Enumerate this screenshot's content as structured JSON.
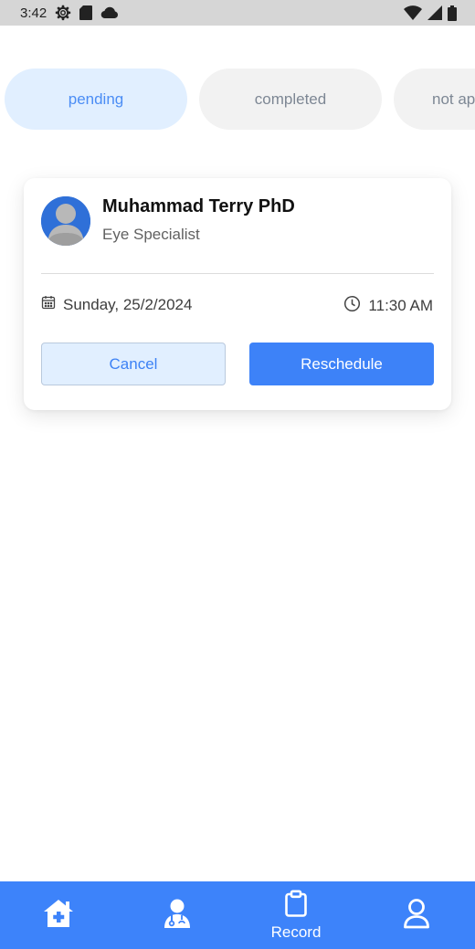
{
  "status_bar": {
    "time": "3:42",
    "icons": [
      "settings-gear-icon",
      "sd-card-icon",
      "cloud-icon",
      "wifi-icon",
      "signal-icon",
      "battery-icon"
    ]
  },
  "tabs": [
    {
      "label": "pending",
      "active": true
    },
    {
      "label": "completed",
      "active": false
    },
    {
      "label": "not ap",
      "active": false
    }
  ],
  "appointment": {
    "doctor_name": "Muhammad Terry PhD",
    "specialty": "Eye Specialist",
    "date": "Sunday, 25/2/2024",
    "time": "11:30 AM",
    "cancel_label": "Cancel",
    "reschedule_label": "Reschedule"
  },
  "bottom_nav": {
    "items": [
      {
        "icon": "home-plus-icon",
        "label": ""
      },
      {
        "icon": "doctor-icon",
        "label": ""
      },
      {
        "icon": "clipboard-icon",
        "label": "Record"
      },
      {
        "icon": "profile-icon",
        "label": ""
      }
    ]
  },
  "colors": {
    "accent": "#3d83fa",
    "tab_active_bg": "#e1efff",
    "tab_active_text": "#4b8df5",
    "tab_inactive_bg": "#f2f2f2",
    "tab_inactive_text": "#7d8794"
  }
}
